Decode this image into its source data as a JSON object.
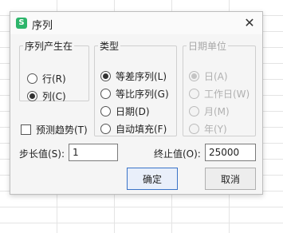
{
  "dialog": {
    "title": "序列",
    "app_icon_glyph": "S",
    "close_glyph": "✕"
  },
  "series_in": {
    "label": "序列产生在",
    "options": [
      {
        "label": "行(R)",
        "checked": false
      },
      {
        "label": "列(C)",
        "checked": true
      }
    ]
  },
  "type": {
    "label": "类型",
    "options": [
      {
        "label": "等差序列(L)",
        "checked": true
      },
      {
        "label": "等比序列(G)",
        "checked": false
      },
      {
        "label": "日期(D)",
        "checked": false
      },
      {
        "label": "自动填充(F)",
        "checked": false
      }
    ]
  },
  "date_unit": {
    "label": "日期单位",
    "disabled": true,
    "options": [
      {
        "label": "日(A)",
        "checked": true
      },
      {
        "label": "工作日(W)",
        "checked": false
      },
      {
        "label": "月(M)",
        "checked": false
      },
      {
        "label": "年(Y)",
        "checked": false
      }
    ]
  },
  "trend": {
    "label": "预测趋势(T)",
    "checked": false
  },
  "step": {
    "label": "步长值(S):",
    "value": "1"
  },
  "stop": {
    "label": "终止值(O):",
    "value": "25000"
  },
  "buttons": {
    "ok": "确定",
    "cancel": "取消"
  }
}
